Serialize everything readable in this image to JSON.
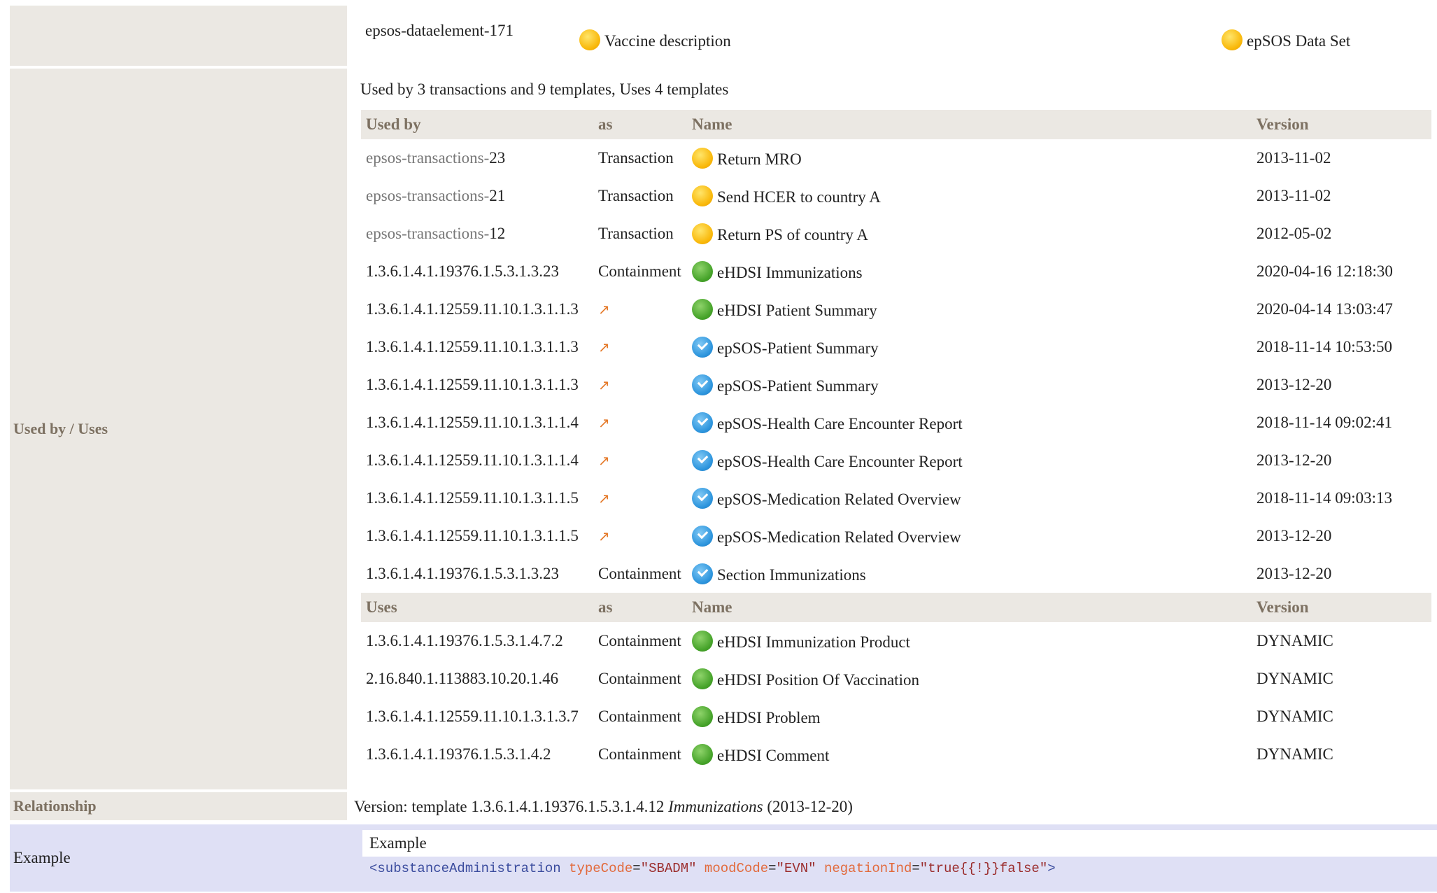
{
  "top_row": {
    "element_id": "epsos-dataelement-171",
    "concept_name": "Vaccine description",
    "dataset_name": "epSOS Data Set"
  },
  "used_by_section": {
    "label": "Used by / Uses",
    "summary": "Used by 3 transactions and 9 templates, Uses 4 templates",
    "used_by_header": {
      "col1": "Used by",
      "col2": "as",
      "col3": "Name",
      "col4": "Version"
    },
    "used_by_rows": [
      {
        "id_prefix": "epsos-transactions-",
        "id_suffix": "23",
        "as": "Transaction",
        "icon": "yellow-status-icon",
        "name": "Return MRO",
        "version": "2013-11-02"
      },
      {
        "id_prefix": "epsos-transactions-",
        "id_suffix": "21",
        "as": "Transaction",
        "icon": "yellow-status-icon",
        "name": "Send HCER to country A",
        "version": "2013-11-02"
      },
      {
        "id_prefix": "epsos-transactions-",
        "id_suffix": "12",
        "as": "Transaction",
        "icon": "yellow-status-icon",
        "name": "Return PS of country A",
        "version": "2012-05-02"
      },
      {
        "id_prefix": "",
        "id_suffix": "1.3.6.1.4.1.19376.1.5.3.1.3.23",
        "as": "Containment",
        "icon": "green-status-icon",
        "name": "eHDSI Immunizations",
        "version": "2020-04-16 12:18:30"
      },
      {
        "id_prefix": "",
        "id_suffix": "1.3.6.1.4.1.12559.11.10.1.3.1.1.3",
        "as": "link-icon",
        "icon": "green-status-icon",
        "name": "eHDSI Patient Summary",
        "version": "2020-04-14 13:03:47"
      },
      {
        "id_prefix": "",
        "id_suffix": "1.3.6.1.4.1.12559.11.10.1.3.1.1.3",
        "as": "link-icon",
        "icon": "blue-check-icon",
        "name": "epSOS-Patient Summary",
        "version": "2018-11-14 10:53:50"
      },
      {
        "id_prefix": "",
        "id_suffix": "1.3.6.1.4.1.12559.11.10.1.3.1.1.3",
        "as": "link-icon",
        "icon": "blue-check-icon",
        "name": "epSOS-Patient Summary",
        "version": "2013-12-20"
      },
      {
        "id_prefix": "",
        "id_suffix": "1.3.6.1.4.1.12559.11.10.1.3.1.1.4",
        "as": "link-icon",
        "icon": "blue-check-icon",
        "name": "epSOS-Health Care Encounter Report",
        "version": "2018-11-14 09:02:41"
      },
      {
        "id_prefix": "",
        "id_suffix": "1.3.6.1.4.1.12559.11.10.1.3.1.1.4",
        "as": "link-icon",
        "icon": "blue-check-icon",
        "name": "epSOS-Health Care Encounter Report",
        "version": "2013-12-20"
      },
      {
        "id_prefix": "",
        "id_suffix": "1.3.6.1.4.1.12559.11.10.1.3.1.1.5",
        "as": "link-icon",
        "icon": "blue-check-icon",
        "name": "epSOS-Medication Related Overview",
        "version": "2018-11-14 09:03:13"
      },
      {
        "id_prefix": "",
        "id_suffix": "1.3.6.1.4.1.12559.11.10.1.3.1.1.5",
        "as": "link-icon",
        "icon": "blue-check-icon",
        "name": "epSOS-Medication Related Overview",
        "version": "2013-12-20"
      },
      {
        "id_prefix": "",
        "id_suffix": "1.3.6.1.4.1.19376.1.5.3.1.3.23",
        "as": "Containment",
        "icon": "blue-check-icon",
        "name": "Section Immunizations",
        "version": "2013-12-20"
      }
    ],
    "uses_header": {
      "col1": "Uses",
      "col2": "as",
      "col3": "Name",
      "col4": "Version"
    },
    "uses_rows": [
      {
        "id": "1.3.6.1.4.1.19376.1.5.3.1.4.7.2",
        "as": "Containment",
        "icon": "green-status-icon",
        "name": "eHDSI Immunization Product",
        "version": "DYNAMIC"
      },
      {
        "id": "2.16.840.1.113883.10.20.1.46",
        "as": "Containment",
        "icon": "green-status-icon",
        "name": "eHDSI Position Of Vaccination",
        "version": "DYNAMIC"
      },
      {
        "id": "1.3.6.1.4.1.12559.11.10.1.3.1.3.7",
        "as": "Containment",
        "icon": "green-status-icon",
        "name": "eHDSI Problem",
        "version": "DYNAMIC"
      },
      {
        "id": "1.3.6.1.4.1.19376.1.5.3.1.4.2",
        "as": "Containment",
        "icon": "green-status-icon",
        "name": "eHDSI Comment",
        "version": "DYNAMIC"
      }
    ]
  },
  "relationship": {
    "label": "Relationship",
    "prefix": "Version: template 1.3.6.1.4.1.19376.1.5.3.1.4.12 ",
    "name": "Immunizations",
    "suffix": " (2013-12-20)"
  },
  "example": {
    "label": "Example",
    "box_title": "Example",
    "code": {
      "open": "<",
      "tag": "substanceAdministration",
      "attr1": "typeCode",
      "val1": "\"SBADM\"",
      "attr2": "moodCode",
      "val2": "\"EVN\"",
      "attr3": "negationInd",
      "val3": "\"true{{!}}false\"",
      "close": ">"
    }
  },
  "colors": {
    "header_bg": "#ebe8e3",
    "header_text": "#7d7162",
    "example_bg": "#dfe0f5",
    "link_orange": "#e57a2a"
  }
}
